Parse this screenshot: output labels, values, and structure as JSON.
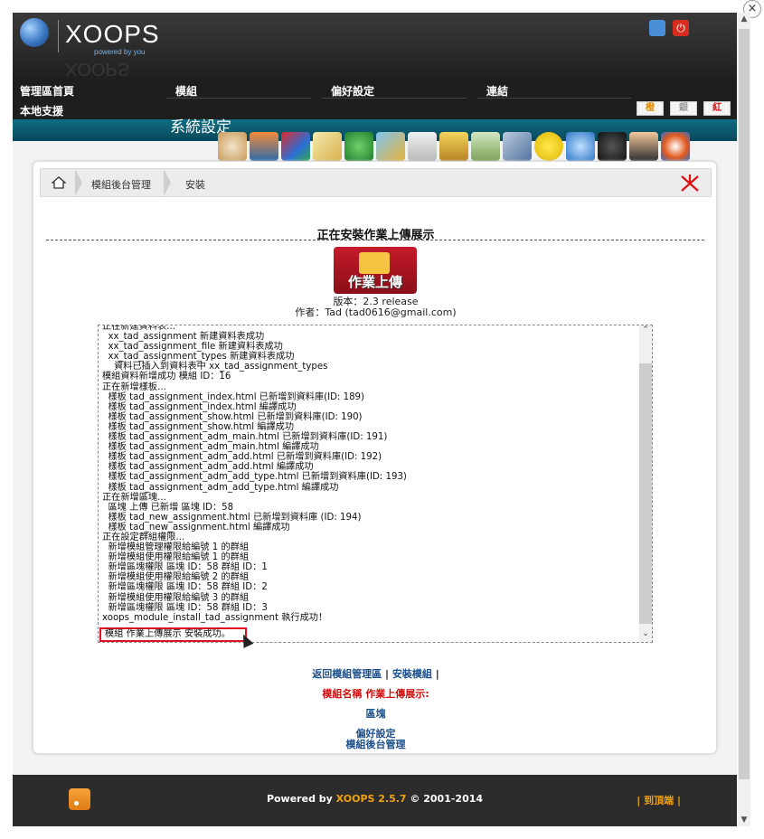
{
  "header": {
    "logo_text": "XOOPS",
    "logo_tagline": "powered by you",
    "logo_reflection": "XOOPS"
  },
  "nav": {
    "items": [
      "管理區首頁",
      "模組",
      "偏好設定",
      "連結"
    ],
    "local_support": "本地支援"
  },
  "band": {
    "title": "系統設定",
    "tabs": [
      "橙",
      "銀",
      "紅"
    ]
  },
  "toolbar_icons": [
    "avatar-icon",
    "banner-icon",
    "blocks-icon",
    "comments-icon",
    "groups-icon",
    "images-icon",
    "maintenance-icon",
    "cleanup-icon",
    "modules-icon",
    "preferences-icon",
    "smilies-icon",
    "tplsets-icon",
    "ranks-icon",
    "users-icon",
    "help-icon"
  ],
  "breadcrumb": {
    "item1": "模組後台管理",
    "item2": "安裝"
  },
  "section_title": "正在安裝作業上傳展示",
  "module": {
    "logo_label": "作業上傳",
    "version": "版本：2.3 release",
    "author": "作者：Tad (tad0616@gmail.com)"
  },
  "log": {
    "lines": [
      "正在新建資料表...",
      "  xx_tad_assignment 新建資料表成功",
      "  xx_tad_assignment_file 新建資料表成功",
      "  xx_tad_assignment_types 新建資料表成功",
      "    資料已插入到資料表中 xx_tad_assignment_types",
      "模組資料新增成功 模組 ID：16",
      "正在新增樣板...",
      "  樣板 tad_assignment_index.html 已新增到資料庫(ID: 189)",
      "  樣板 tad_assignment_index.html 編譯成功",
      "  樣板 tad_assignment_show.html 已新增到資料庫(ID: 190)",
      "  樣板 tad_assignment_show.html 編譯成功",
      "  樣板 tad_assignment_adm_main.html 已新增到資料庫(ID: 191)",
      "  樣板 tad_assignment_adm_main.html 編譯成功",
      "  樣板 tad_assignment_adm_add.html 已新增到資料庫(ID: 192)",
      "  樣板 tad_assignment_adm_add.html 編譯成功",
      "  樣板 tad_assignment_adm_add_type.html 已新增到資料庫(ID: 193)",
      "  樣板 tad_assignment_adm_add_type.html 編譯成功",
      "正在新增區塊...",
      "  區塊 上傳 已新增 區塊 ID：58",
      "  樣板 tad_new_assignment.html 已新增到資料庫 (ID: 194)",
      "  樣板 tad_new_assignment.html 編譯成功",
      "正在設定群組權限...",
      "  新增模組管理權限給編號 1 的群組",
      "  新增模組使用權限給編號 1 的群組",
      "  新增區塊權限 區塊 ID：58 群組 ID：1",
      "  新增模組使用權限給編號 2 的群組",
      "  新增區塊權限 區塊 ID：58 群組 ID：2",
      "  新增模組使用權限給編號 3 的群組",
      "  新增區塊權限 區塊 ID：58 群組 ID：3",
      "xoops_module_install_tad_assignment 執行成功！"
    ],
    "success": "模組 作業上傳展示 安裝成功。"
  },
  "links": {
    "back": "返回模組管理區",
    "install": "安裝模組",
    "pipe": "|",
    "module_name": "模組名稱 作業上傳展示:",
    "blocks": "區塊",
    "preferences": "偏好設定",
    "module_admin": "模組後台管理"
  },
  "footer": {
    "powered_prefix": "Powered by ",
    "powered_brand": "XOOPS 2.5.7",
    "powered_suffix": " © 2001-2014",
    "right_text": "| 到頂端 |"
  }
}
